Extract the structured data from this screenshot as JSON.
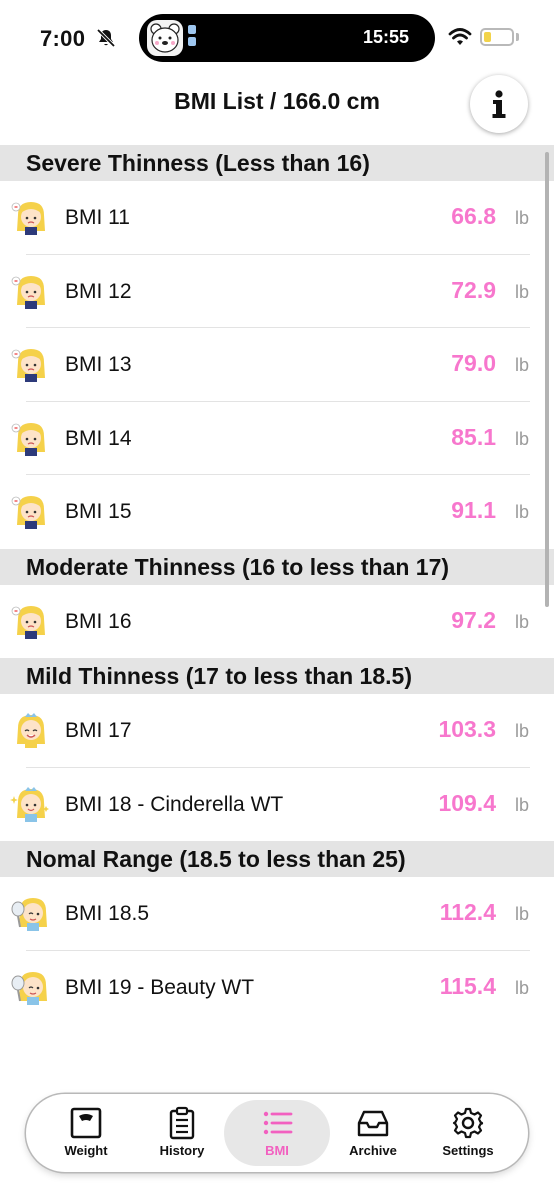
{
  "status_bar": {
    "time": "7:00",
    "island_time": "15:55"
  },
  "header": {
    "title": "BMI List / 166.0 cm"
  },
  "sections": [
    {
      "title": "Severe Thinness (Less than 16)",
      "rows": [
        {
          "label": "BMI 11",
          "weight": "66.8",
          "unit": "lb"
        },
        {
          "label": "BMI 12",
          "weight": "72.9",
          "unit": "lb"
        },
        {
          "label": "BMI 13",
          "weight": "79.0",
          "unit": "lb"
        },
        {
          "label": "BMI 14",
          "weight": "85.1",
          "unit": "lb"
        },
        {
          "label": "BMI 15",
          "weight": "91.1",
          "unit": "lb"
        }
      ]
    },
    {
      "title": "Moderate Thinness (16 to less than 17)",
      "rows": [
        {
          "label": "BMI 16",
          "weight": "97.2",
          "unit": "lb"
        }
      ]
    },
    {
      "title": "Mild Thinness (17 to less than 18.5)",
      "rows": [
        {
          "label": "BMI 17",
          "weight": "103.3",
          "unit": "lb"
        },
        {
          "label": "BMI 18 - Cinderella WT",
          "weight": "109.4",
          "unit": "lb"
        }
      ]
    },
    {
      "title": "Nomal Range (18.5 to less than 25)",
      "rows": [
        {
          "label": "BMI 18.5",
          "weight": "112.4",
          "unit": "lb"
        },
        {
          "label": "BMI 19 - Beauty WT",
          "weight": "115.4",
          "unit": "lb"
        }
      ]
    }
  ],
  "tabs": [
    {
      "label": "Weight",
      "icon": "scale-icon"
    },
    {
      "label": "History",
      "icon": "clipboard-icon"
    },
    {
      "label": "BMI",
      "icon": "list-icon",
      "active": true
    },
    {
      "label": "Archive",
      "icon": "archive-tray-icon"
    },
    {
      "label": "Settings",
      "icon": "gear-icon"
    }
  ],
  "colors": {
    "accent": "#f777cd",
    "tab_active": "#f260c0",
    "section_bg": "#e4e4e4"
  }
}
